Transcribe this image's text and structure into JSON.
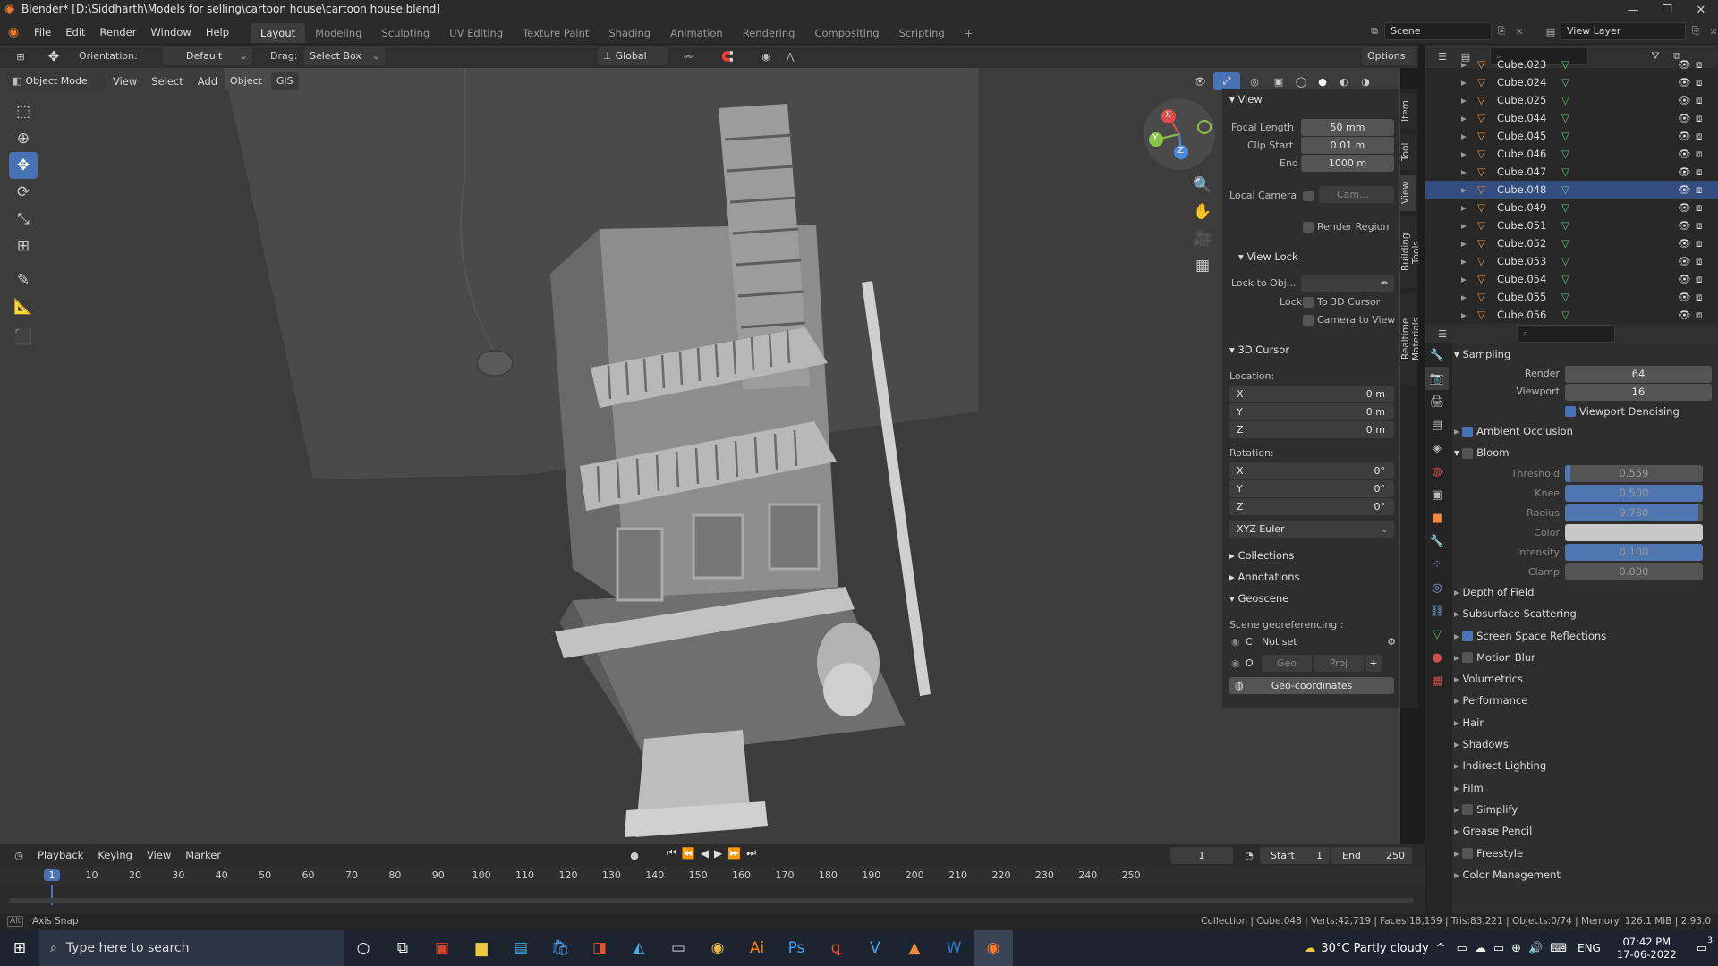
{
  "title_bar": {
    "title": "Blender* [D:\\Siddharth\\Models for selling\\cartoon house\\cartoon house.blend]",
    "minimize": "—",
    "maximize": "❐",
    "close": "✕"
  },
  "menu": [
    "File",
    "Edit",
    "Render",
    "Window",
    "Help"
  ],
  "workspaces": [
    "Layout",
    "Modeling",
    "Sculpting",
    "UV Editing",
    "Texture Paint",
    "Shading",
    "Animation",
    "Rendering",
    "Compositing",
    "Scripting",
    "+"
  ],
  "active_workspace": "Layout",
  "scene_field": "Scene",
  "view_layer_field": "View Layer",
  "header": {
    "orientation_label": "Orientation:",
    "orientation_value": "Default",
    "drag_label": "Drag:",
    "drag_value": "Select Box",
    "transform_orientation": "Global",
    "options": "Options"
  },
  "viewport_header": {
    "mode": "Object Mode",
    "menus": [
      "View",
      "Select",
      "Add",
      "Object",
      "GIS"
    ]
  },
  "gizmo": {
    "x": "X",
    "y": "Y",
    "z": "Z"
  },
  "npanel": {
    "tabs": [
      "Item",
      "Tool",
      "View",
      "Building Tools",
      "Realtime Materials"
    ],
    "view_section": "View",
    "focal_length_label": "Focal Length",
    "focal_length": "50 mm",
    "clip_start_label": "Clip Start",
    "clip_start": "0.01 m",
    "end_label": "End",
    "end": "1000 m",
    "local_camera_label": "Local Camera",
    "camera_field": "Cam...",
    "render_region": "Render Region",
    "view_lock_section": "View Lock",
    "lock_to_obj_label": "Lock to Obj...",
    "lock_label": "Lock",
    "to_3d_cursor": "To 3D Cursor",
    "camera_to_view": "Camera to View",
    "cursor_section": "3D Cursor",
    "location_label": "Location:",
    "loc": [
      {
        "axis": "X",
        "value": "0 m"
      },
      {
        "axis": "Y",
        "value": "0 m"
      },
      {
        "axis": "Z",
        "value": "0 m"
      }
    ],
    "rotation_label": "Rotation:",
    "rot": [
      {
        "axis": "X",
        "value": "0°"
      },
      {
        "axis": "Y",
        "value": "0°"
      },
      {
        "axis": "Z",
        "value": "0°"
      }
    ],
    "rotation_mode": "XYZ Euler",
    "collections": "Collections",
    "annotations": "Annotations",
    "geoscene": "Geoscene",
    "georef_label": "Scene georeferencing :",
    "c_label": "C",
    "not_set": "Not set",
    "o_label": "O",
    "geo": "Geo",
    "proj": "Proj",
    "geo_coordinates": "Geo-coordinates"
  },
  "outliner": {
    "rows": [
      {
        "name": "Cube.023",
        "sel": false
      },
      {
        "name": "Cube.024",
        "sel": false
      },
      {
        "name": "Cube.025",
        "sel": false
      },
      {
        "name": "Cube.044",
        "sel": false
      },
      {
        "name": "Cube.045",
        "sel": false
      },
      {
        "name": "Cube.046",
        "sel": false
      },
      {
        "name": "Cube.047",
        "sel": false
      },
      {
        "name": "Cube.048",
        "sel": true
      },
      {
        "name": "Cube.049",
        "sel": false
      },
      {
        "name": "Cube.051",
        "sel": false
      },
      {
        "name": "Cube.052",
        "sel": false
      },
      {
        "name": "Cube.053",
        "sel": false
      },
      {
        "name": "Cube.054",
        "sel": false
      },
      {
        "name": "Cube.055",
        "sel": false
      },
      {
        "name": "Cube.056",
        "sel": false
      }
    ]
  },
  "properties": {
    "sampling": "Sampling",
    "render_label": "Render",
    "render": "64",
    "viewport_label": "Viewport",
    "viewport": "16",
    "viewport_denoising": "Viewport Denoising",
    "ambient_occlusion": "Ambient Occlusion",
    "bloom": "Bloom",
    "bloom_fields": [
      {
        "label": "Threshold",
        "value": "0.559",
        "fill": 0.04
      },
      {
        "label": "Knee",
        "value": "0.500",
        "fill": 1.0
      },
      {
        "label": "Radius",
        "value": "9.730",
        "fill": 0.97
      },
      {
        "label": "Color",
        "value": "",
        "fill": 0
      },
      {
        "label": "Intensity",
        "value": "0.100",
        "fill": 1.0
      },
      {
        "label": "Clamp",
        "value": "0.000",
        "fill": 0
      }
    ],
    "sections": [
      {
        "label": "Depth of Field",
        "check": null
      },
      {
        "label": "Subsurface Scattering",
        "check": null
      },
      {
        "label": "Screen Space Reflections",
        "check": true
      },
      {
        "label": "Motion Blur",
        "check": false
      },
      {
        "label": "Volumetrics",
        "check": null
      },
      {
        "label": "Performance",
        "check": null
      },
      {
        "label": "Hair",
        "check": null
      },
      {
        "label": "Shadows",
        "check": null
      },
      {
        "label": "Indirect Lighting",
        "check": null
      },
      {
        "label": "Film",
        "check": null
      },
      {
        "label": "Simplify",
        "check": false
      },
      {
        "label": "Grease Pencil",
        "check": null
      },
      {
        "label": "Freestyle",
        "check": false
      },
      {
        "label": "Color Management",
        "check": null
      }
    ]
  },
  "timeline": {
    "menus": [
      "Playback",
      "Keying",
      "View",
      "Marker"
    ],
    "current_frame": "1",
    "start_label": "Start",
    "start": "1",
    "end_label": "End",
    "end": "250",
    "ticks": [
      "1",
      "10",
      "20",
      "30",
      "40",
      "50",
      "60",
      "70",
      "80",
      "90",
      "100",
      "110",
      "120",
      "130",
      "140",
      "150",
      "160",
      "170",
      "180",
      "190",
      "200",
      "210",
      "220",
      "230",
      "240",
      "250"
    ]
  },
  "status": {
    "left": "Axis Snap",
    "right": "Collection | Cube.048 | Verts:42,719 | Faces:18,159 | Tris:83,221 | Objects:0/74 | Memory: 126.1 MiB | 2.93.0"
  },
  "taskbar": {
    "search": "Type here to search",
    "weather": "30°C  Partly cloudy",
    "lang": "ENG",
    "time": "07:42 PM",
    "date": "17-06-2022",
    "notif": "3"
  }
}
